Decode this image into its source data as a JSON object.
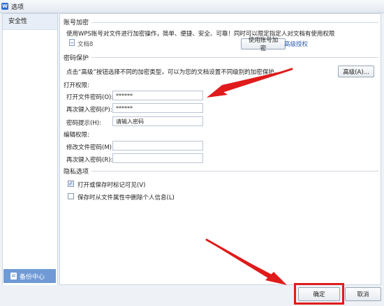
{
  "window": {
    "app_icon": "W",
    "title": "选项"
  },
  "sidebar": {
    "items": [
      {
        "label": "安全性"
      }
    ]
  },
  "backup": {
    "label": "备份中心"
  },
  "account": {
    "group_title": "账号加密",
    "description": "使用WPS账号对文件进行加密操作，简单、便捷、安全、可靠！同时可以限定指定人对文档有使用权限",
    "doc_name": "文档8",
    "encrypt_button": "使用账号加密",
    "advanced_auth_link": "高级授权"
  },
  "password_protection": {
    "group_title": "密码保护",
    "description": "点击“高级”按钮选择不同的加密类型，可以为您的文档设置不同级别的加密保护。",
    "advanced_button": "高级(A)...",
    "open_permission": {
      "title": "打开权限:",
      "open_password_label": "打开文件密码(O):",
      "open_password_value": "******",
      "reenter_label": "再次键入密码(P):",
      "reenter_value": "******",
      "hint_label": "密码提示(H):",
      "hint_placeholder": "请输入密码"
    },
    "edit_permission": {
      "title": "编辑权限:",
      "modify_password_label": "修改文件密码(M):",
      "modify_password_value": "",
      "reenter_label": "再次键入密码(R):",
      "reenter_value": ""
    }
  },
  "privacy": {
    "group_title": "隐私选项",
    "option1": {
      "label": "打开或保存时标记可见(V)",
      "checked": true,
      "mark": "✓"
    },
    "option2": {
      "label": "保存时从文件属性中删除个人信息(L)",
      "checked": false
    }
  },
  "footer": {
    "ok_label": "确定",
    "cancel_label": "取消"
  },
  "colors": {
    "accent": "#2a5db0",
    "annotation_red": "#e01b1b",
    "backup_button": "#6f9ad6"
  }
}
